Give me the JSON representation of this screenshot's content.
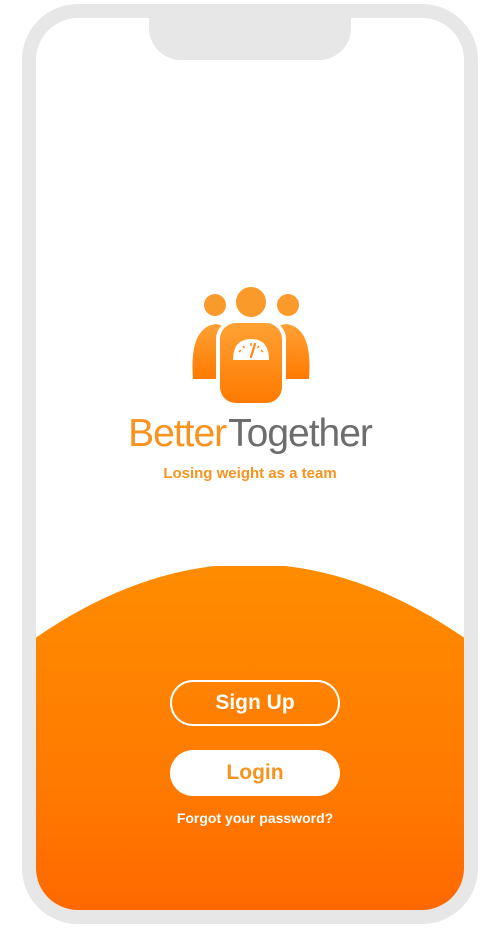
{
  "brand": {
    "name_part1": "Better",
    "name_part2": "Together",
    "tagline": "Losing weight as a team",
    "logo_icon": "team-scale-icon"
  },
  "actions": {
    "signup_label": "Sign Up",
    "login_label": "Login",
    "forgot_label": "Forgot your password?"
  },
  "colors": {
    "accent": "#f7931e",
    "accent_dark": "#ff6a00",
    "brand_grey": "#6d6d6d",
    "frame": "#e7e7e7",
    "background": "#ffffff"
  }
}
